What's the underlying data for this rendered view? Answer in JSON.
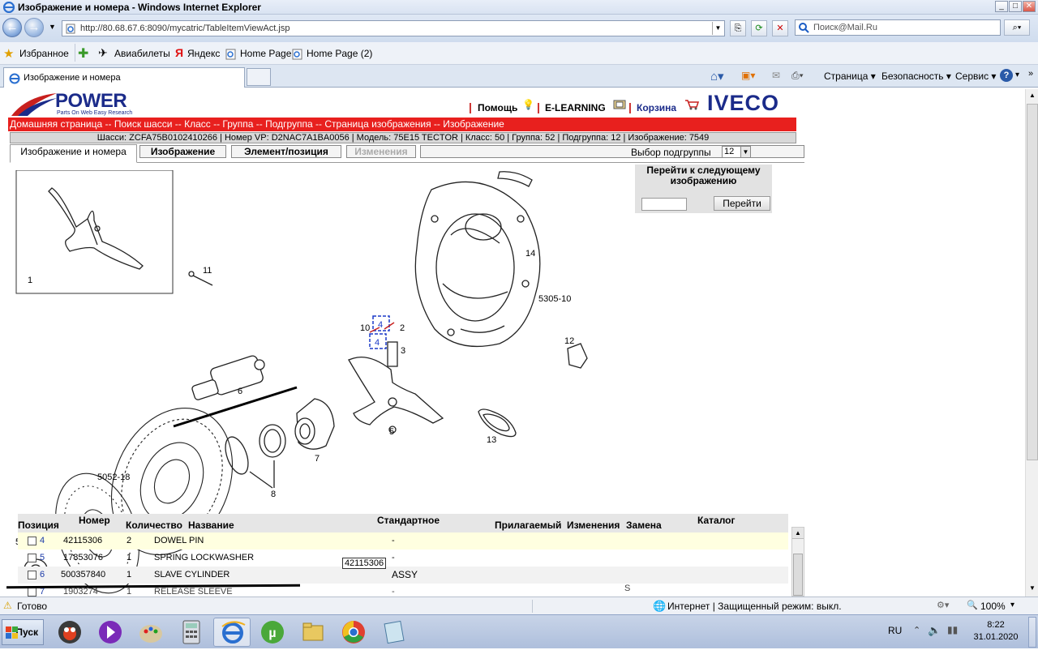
{
  "window": {
    "title": "Изображение и номера - Windows Internet Explorer",
    "minimize": "_",
    "maximize": "□",
    "close": "✕"
  },
  "nav": {
    "address": "http://80.68.67.6:8090/mycatric/TableItemViewAct.jsp",
    "search_placeholder": "Поиск@Mail.Ru"
  },
  "favorites": {
    "items": [
      "Избранное",
      "Авиабилеты",
      "Яндекс",
      "Home Page",
      "Home Page (2)"
    ]
  },
  "tabs": {
    "active": "Изображение и номера"
  },
  "commandbar": {
    "page": "Страница",
    "safety": "Безопасность",
    "service": "Сервис"
  },
  "header": {
    "logo_text": "POWER",
    "logo_sub": "Parts On Web Easy Research",
    "help": "Помощь",
    "elearning": "E-LEARNING",
    "cart": "Корзина",
    "brand": "IVECO",
    "breadcrumb": "Домашняя страница -- Поиск шасси -- Класс -- Группа -- Подгруппа -- Страница изображения -- Изображение",
    "info": "Шасси: ZCFA75B0102410266 | Номер VP: D2NAC7A1BA0056 | Модель: 75E15 TECTOR | Класс: 50 | Группа: 52 | Подгруппа: 12 | Изображение: 7549"
  },
  "pagetabs": {
    "tab_images_numbers": "Изображение и номера",
    "tab_image": "Изображение",
    "tab_element": "Элемент/позиция",
    "tab_changes": "Изменения",
    "subgroup_label": "Выбор подгруппы",
    "subgroup_value": "12"
  },
  "goto": {
    "label": "Перейти к следующему изображению",
    "button": "Перейти"
  },
  "diagram": {
    "callouts": [
      "1",
      "11",
      "6",
      "5052-18",
      "5052-18",
      "8",
      "7",
      "10",
      "4",
      "4",
      "2",
      "3",
      "5",
      "14",
      "5305-10",
      "12",
      "13"
    ]
  },
  "table": {
    "headers": [
      "Позиция",
      "Номер",
      "Количество",
      "Название",
      "Стандартное",
      "Прилагаемый",
      "Изменения",
      "Замена",
      "Каталог"
    ],
    "rows": [
      {
        "pos": "4",
        "number": "42115306",
        "qty": "2",
        "name": "DOWEL PIN",
        "std": "-",
        "extra": ""
      },
      {
        "pos": "5",
        "number": "17853076",
        "qty": "1",
        "name": "SPRING LOCKWASHER",
        "std": "-",
        "extra": ""
      },
      {
        "pos": "6",
        "number": "500357840",
        "qty": "1",
        "name": "SLAVE CYLINDER",
        "std": "ASSY",
        "extra": ""
      },
      {
        "pos": "7",
        "number": "1903274",
        "qty": "1",
        "name": "RELEASE SLEEVE",
        "std": "-",
        "extra": "S"
      }
    ],
    "tooltip": "42115306"
  },
  "status": {
    "text": "Готово",
    "zone": "Интернет | Защищенный режим: выкл.",
    "zoom": "100%"
  },
  "taskbar": {
    "start": "Пуск",
    "lang": "RU",
    "time": "8:22",
    "date": "31.01.2020"
  }
}
